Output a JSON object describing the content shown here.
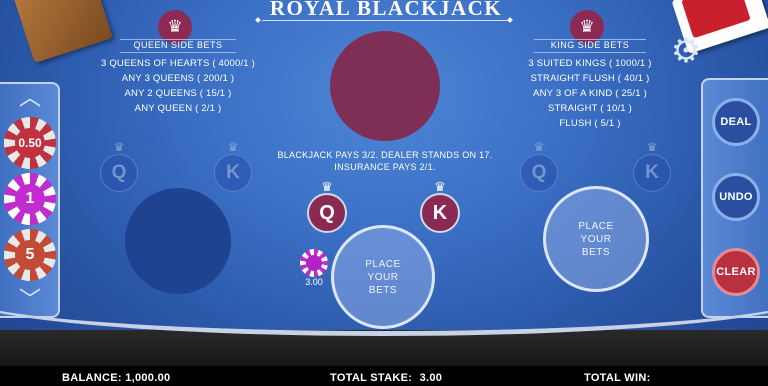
{
  "title": "ROYAL BLACKJACK",
  "queen_side_bets": {
    "title": "QUEEN SIDE BETS",
    "lines": [
      "3 QUEENS OF HEARTS ( 4000/1 )",
      "ANY 3 QUEENS ( 200/1 )",
      "ANY 2 QUEENS ( 15/1 )",
      "ANY QUEEN ( 2/1 )"
    ]
  },
  "king_side_bets": {
    "title": "KING SIDE BETS",
    "lines": [
      "3 SUITED KINGS ( 1000/1 )",
      "STRAIGHT FLUSH ( 40/1 )",
      "ANY 3 OF A KIND ( 25/1 )",
      "STRAIGHT ( 10/1 )",
      "FLUSH ( 5/1 )"
    ]
  },
  "rules": {
    "line1": "BLACKJACK PAYS 3/2.  DEALER STANDS ON 17.",
    "line2": "INSURANCE PAYS 2/1."
  },
  "spots": {
    "queen": "Q",
    "king": "K",
    "crown_glyph": "♛",
    "place_bets_center": [
      "PLACE",
      "YOUR",
      "BETS"
    ],
    "place_bets_right": [
      "PLACE",
      "YOUR",
      "BETS"
    ]
  },
  "chips": [
    {
      "value": "0.50",
      "color": "#c0323f"
    },
    {
      "value": "1",
      "color": "#c22bcf"
    },
    {
      "value": "5",
      "color": "#c24a37"
    }
  ],
  "placed_chip": {
    "amount": "3.00",
    "color": "#c22bcf"
  },
  "buttons": {
    "deal": "DEAL",
    "undo": "UNDO",
    "clear": "CLEAR"
  },
  "status": {
    "balance_label": "BALANCE:",
    "balance_value": "1,000.00",
    "stake_label": "TOTAL STAKE:",
    "stake_value": "3.00",
    "win_label": "TOTAL WIN:",
    "win_value": ""
  },
  "icons": {
    "gear": "gear-icon",
    "chevron_up": "chevron-up-icon",
    "chevron_down": "chevron-down-icon",
    "crown": "crown-icon"
  },
  "colors": {
    "felt": "#3a6fc4",
    "dealer_circle": "#7f2f56",
    "accent_red": "#8a2a52",
    "clear_button": "#b9303f",
    "deal_undo_button": "#2a4fa0"
  }
}
